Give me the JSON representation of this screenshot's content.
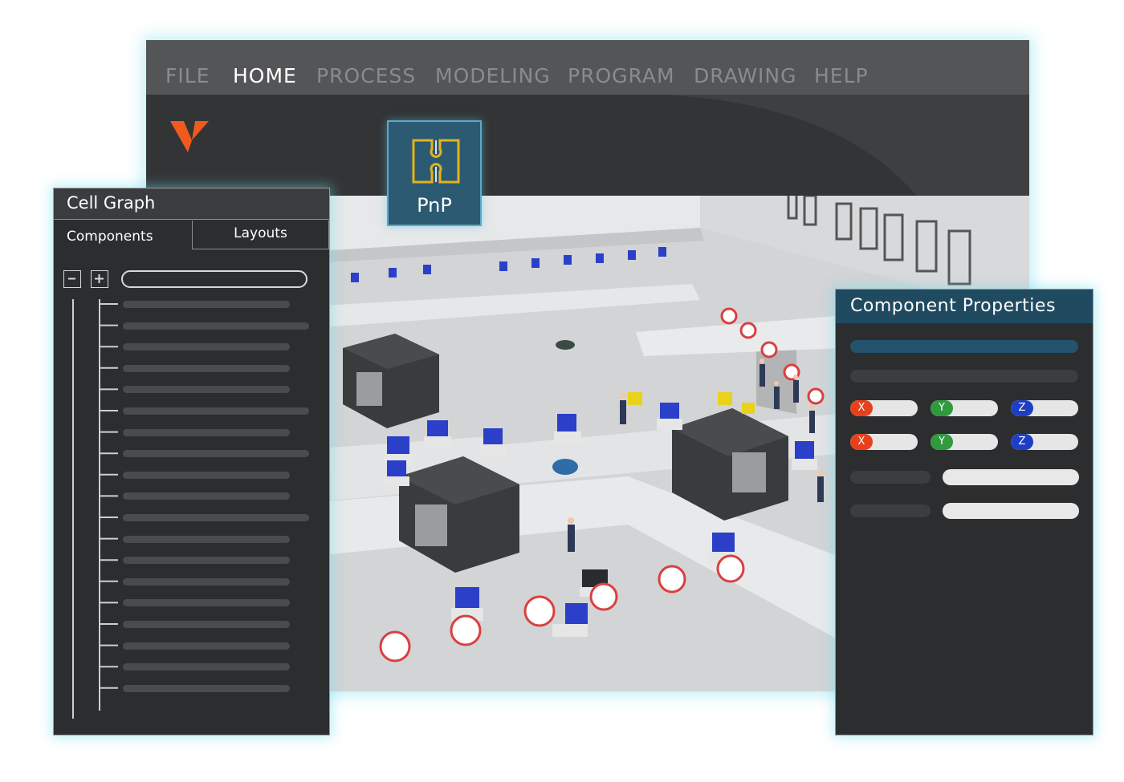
{
  "menu": {
    "items": [
      {
        "label": "FILE",
        "active": false
      },
      {
        "label": "HOME",
        "active": true
      },
      {
        "label": "PROCESS",
        "active": false
      },
      {
        "label": "MODELING",
        "active": false
      },
      {
        "label": "PROGRAM",
        "active": false
      },
      {
        "label": "DRAWING",
        "active": false
      },
      {
        "label": "HELP",
        "active": false
      }
    ]
  },
  "ribbon": {
    "pnp_label": "PnP"
  },
  "cell_graph": {
    "title": "Cell Graph",
    "tabs": {
      "components": "Components",
      "layouts": "Layouts"
    },
    "collapse_icon": "minus-icon",
    "expand_icon": "plus-icon",
    "search_value": ""
  },
  "component_properties": {
    "title": "Component Properties",
    "axis_rows": [
      [
        {
          "axis": "X",
          "color": "#e8401c"
        },
        {
          "axis": "Y",
          "color": "#2f9a3e"
        },
        {
          "axis": "Z",
          "color": "#1e3fc4"
        }
      ],
      [
        {
          "axis": "X",
          "color": "#e8401c"
        },
        {
          "axis": "Y",
          "color": "#2f9a3e"
        },
        {
          "axis": "Z",
          "color": "#1e3fc4"
        }
      ]
    ]
  },
  "colors": {
    "accent": "#2c5a73",
    "logo": "#f05a1e",
    "glow": "#6edceb"
  }
}
